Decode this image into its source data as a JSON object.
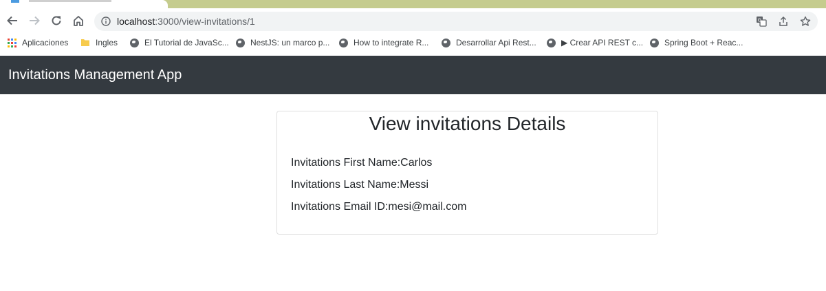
{
  "browser": {
    "url_host": "localhost",
    "url_path": ":3000/view-invitations/1",
    "bookmarks": [
      {
        "label": "Aplicaciones",
        "icon": "apps-grid-icon"
      },
      {
        "label": "Ingles",
        "icon": "folder-icon"
      },
      {
        "label": "El Tutorial de JavaSc...",
        "icon": "globe-icon"
      },
      {
        "label": "NestJS: un marco p...",
        "icon": "globe-icon"
      },
      {
        "label": "How to integrate R...",
        "icon": "globe-icon"
      },
      {
        "label": "Desarrollar Api Rest...",
        "icon": "globe-icon"
      },
      {
        "label": "▶ Crear API REST c...",
        "icon": "globe-icon"
      },
      {
        "label": "Spring Boot + Reac...",
        "icon": "globe-icon"
      }
    ]
  },
  "app": {
    "brand": "Invitations Management App",
    "card": {
      "title": "View invitations Details",
      "fields": [
        {
          "label": "Invitations First Name:",
          "value": "Carlos"
        },
        {
          "label": "Invitations Last Name:",
          "value": "Messi"
        },
        {
          "label": "Invitations Email ID:",
          "value": "mesi@mail.com"
        }
      ]
    }
  },
  "colors": {
    "navbar_bg": "#343a40",
    "tab_strip": "#c5cc8e",
    "omnibox_bg": "#f1f3f4"
  }
}
